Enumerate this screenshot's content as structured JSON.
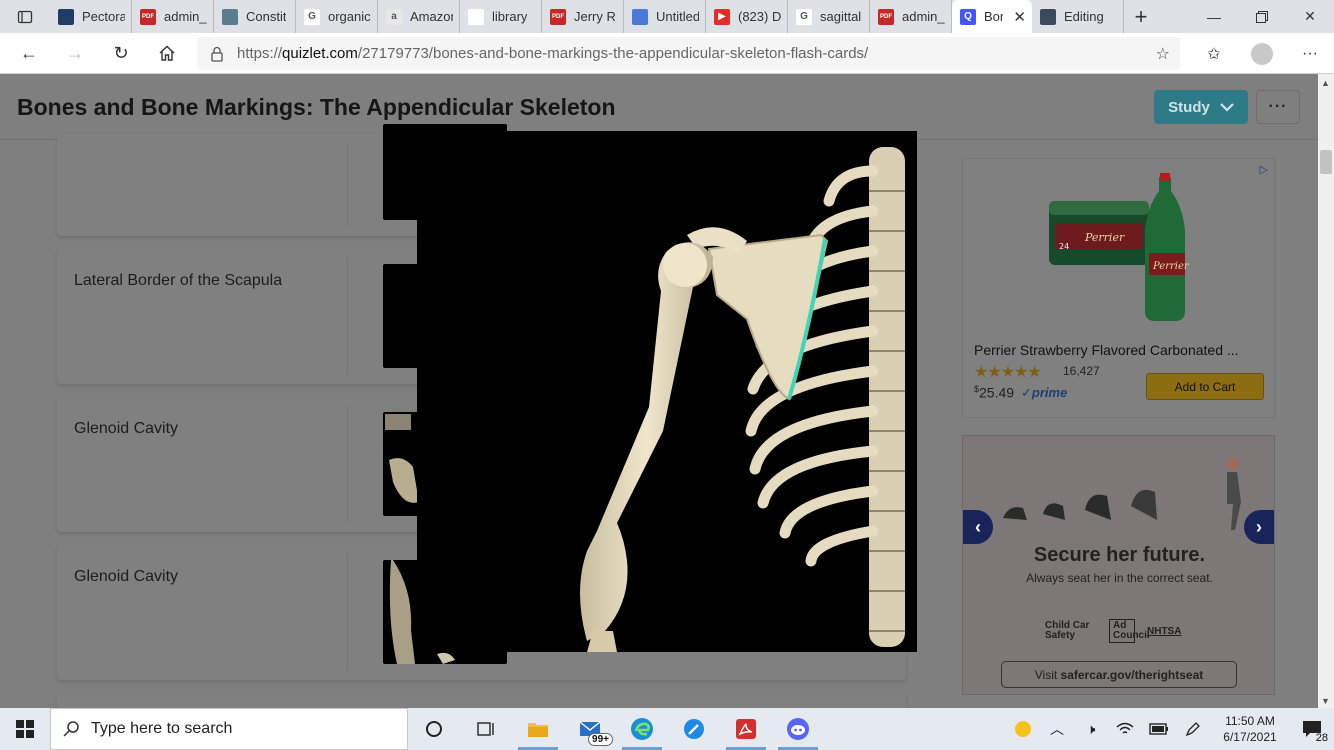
{
  "browser": {
    "tabs": [
      {
        "label": "Pectora",
        "fav_color": "#1f3b66",
        "fav_text": ""
      },
      {
        "label": "admin_",
        "fav_color": "#c62828",
        "fav_text": "PDF"
      },
      {
        "label": "Constit",
        "fav_color": "#5a7d8c",
        "fav_text": ""
      },
      {
        "label": "organic",
        "fav_color": "#ffffff",
        "fav_text": "G"
      },
      {
        "label": "Amazon",
        "fav_color": "#e7e7e7",
        "fav_text": "a"
      },
      {
        "label": "library",
        "fav_color": "#ffffff",
        "fav_text": ""
      },
      {
        "label": "Jerry R.",
        "fav_color": "#ffffff",
        "fav_text": "PDF"
      },
      {
        "label": "Untitled",
        "fav_color": "#4a7bd8",
        "fav_text": ""
      },
      {
        "label": "(823) D",
        "fav_color": "#e52d27",
        "fav_text": "▶"
      },
      {
        "label": "sagittal",
        "fav_color": "#ffffff",
        "fav_text": "G"
      },
      {
        "label": "admin_",
        "fav_color": "#c62828",
        "fav_text": "PDF"
      },
      {
        "label": "Bor",
        "fav_color": "#4255ff",
        "fav_text": "Q",
        "active": true
      },
      {
        "label": "Editing",
        "fav_color": "#3b4a5a",
        "fav_text": ""
      }
    ],
    "url_prefix": "https://",
    "url_host": "quizlet.com",
    "url_path": "/27179773/bones-and-bone-markings-the-appendicular-skeleton-flash-cards/"
  },
  "page": {
    "title": "Bones and Bone Markings: The Appendicular Skeleton",
    "study_label": "Study",
    "more_label": "···",
    "cards": [
      {
        "term": ""
      },
      {
        "term": "Lateral Border of the Scapula"
      },
      {
        "term": "Glenoid Cavity"
      },
      {
        "term": "Glenoid Cavity"
      }
    ]
  },
  "ads": {
    "product": {
      "title": "Perrier Strawberry Flavored Carbonated ...",
      "stars": "★★★★★",
      "reviews": "16,427",
      "price_symbol": "$",
      "price": "25.49",
      "prime": "✓prime",
      "cart_label": "Add to Cart"
    },
    "psa": {
      "headline": "Secure her future.",
      "subline": "Always seat her in the correct seat.",
      "logo1": "Child Car Safety",
      "logo2": "Ad Council",
      "logo3": "NHTSA",
      "visit_prefix": "Visit ",
      "visit_url": "safercar.gov/therightseat"
    }
  },
  "taskbar": {
    "search_placeholder": "Type here to search",
    "mail_badge": "99+",
    "time": "11:50 AM",
    "date": "6/17/2021",
    "notifications": "28"
  },
  "colors": {
    "quizlet_blue": "#4255ff",
    "study_button": "#2e7b88",
    "highlight_border": "#3fd6b8"
  }
}
